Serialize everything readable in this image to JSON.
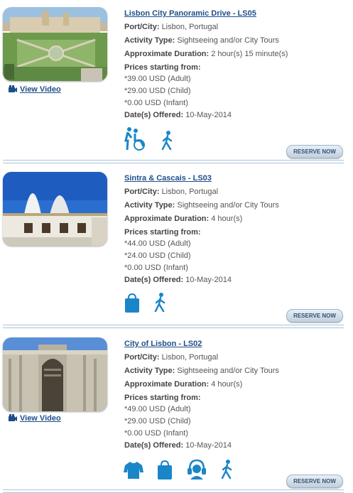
{
  "labels": {
    "port": "Port/City:",
    "activity": "Activity Type:",
    "duration": "Approximate Duration:",
    "prices": "Prices starting from:",
    "dates": "Date(s) Offered:",
    "view_video": "View Video",
    "reserve": "RESERVE NOW"
  },
  "tours": [
    {
      "title": "Lisbon City Panoramic Drive - LS05",
      "port": "Lisbon, Portugal",
      "activity": "Sightseeing and/or City Tours",
      "duration": "2 hour(s) 15 minute(s)",
      "price_adult": "*39.00 USD (Adult)",
      "price_child": "*29.00 USD (Child)",
      "price_infant": "*0.00 USD (Infant)",
      "dates": "10-May-2014",
      "icons": [
        "wheelchair-accessible-icon",
        "walking-icon"
      ]
    },
    {
      "title": "Sintra & Cascais - LS03",
      "port": "Lisbon, Portugal",
      "activity": "Sightseeing and/or City Tours",
      "duration": "4 hour(s)",
      "price_adult": "*44.00 USD (Adult)",
      "price_child": "*24.00 USD (Child)",
      "price_infant": "*0.00 USD (Infant)",
      "dates": "10-May-2014",
      "icons": [
        "shopping-bag-icon",
        "walking-icon"
      ]
    },
    {
      "title": "City of Lisbon - LS02",
      "port": "Lisbon, Portugal",
      "activity": "Sightseeing and/or City Tours",
      "duration": "4 hour(s)",
      "price_adult": "*49.00 USD (Adult)",
      "price_child": "*29.00 USD (Child)",
      "price_infant": "*0.00 USD (Infant)",
      "dates": "10-May-2014",
      "icons": [
        "dress-code-icon",
        "shopping-bag-icon",
        "audio-guide-icon",
        "walking-icon"
      ]
    }
  ],
  "colors": {
    "link": "#1d4e88",
    "icon": "#1a86c8",
    "separator": "#a9c3da"
  }
}
